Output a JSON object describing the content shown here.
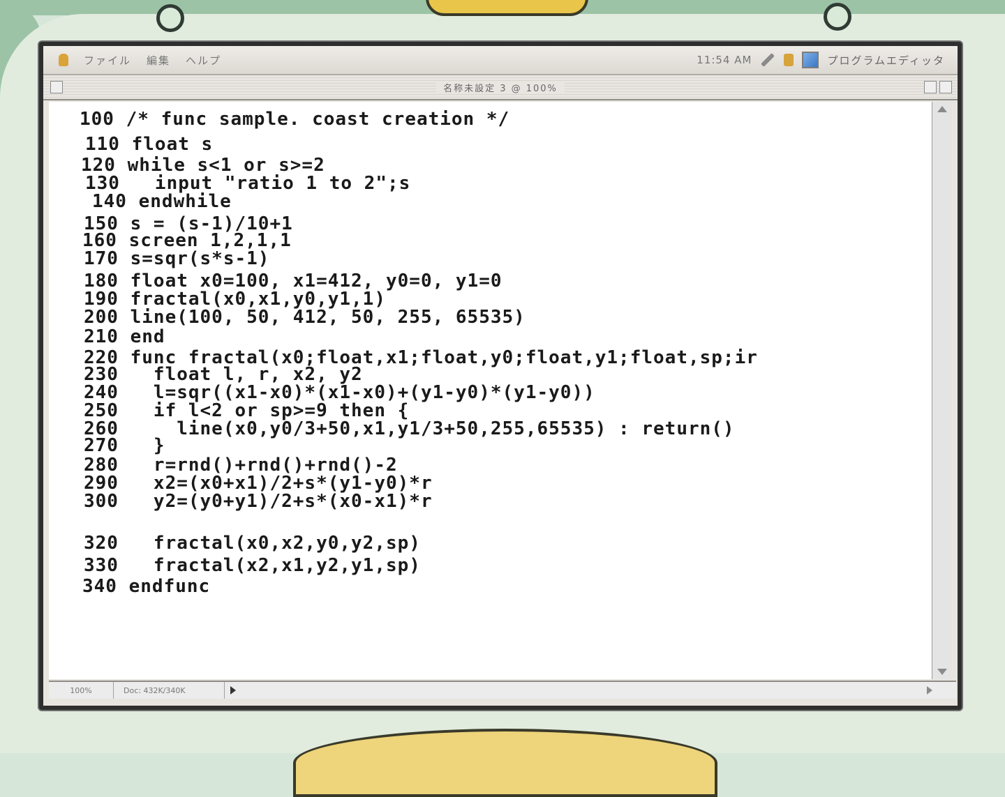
{
  "menubar": {
    "items": [
      "ファイル",
      "編集",
      "ヘルプ"
    ],
    "clock": "11:54 AM",
    "app_name": "プログラムエディッタ"
  },
  "window": {
    "title": "名称未設定 3 @ 100%"
  },
  "editor": {
    "lines": [
      "100 /* func sample. coast creation */",
      "110 float s",
      "120 while s<1 or s>=2",
      "130   input \"ratio 1 to 2\";s",
      "140 endwhile",
      "150 s = (s-1)/10+1",
      "160 screen 1,2,1,1",
      "170 s=sqr(s*s-1)",
      "180 float x0=100, x1=412, y0=0, y1=0",
      "190 fractal(x0,x1,y0,y1,1)",
      "200 line(100, 50, 412, 50, 255, 65535)",
      "210 end",
      "220 func fractal(x0;float,x1;float,y0;float,y1;float,sp;ir",
      "230   float l, r, x2, y2",
      "240   l=sqr((x1-x0)*(x1-x0)+(y1-y0)*(y1-y0))",
      "250   if l<2 or sp>=9 then {",
      "260     line(x0,y0/3+50,x1,y1/3+50,255,65535) : return()",
      "270   }",
      "280   r=rnd()+rnd()+rnd()-2",
      "290   x2=(x0+x1)/2+s*(y1-y0)*r",
      "300   y2=(y0+y1)/2+s*(x0-x1)*r",
      "320   fractal(x0,x2,y0,y2,sp)",
      "330   fractal(x2,x1,y2,y1,sp)",
      "340 endfunc"
    ]
  },
  "statusbar": {
    "zoom": "100%",
    "doc_info": "Doc: 432K/340K"
  },
  "colors": {
    "backdrop": "#d6e6d8",
    "accent_yellow": "#e9c54a",
    "editor_background": "#ffffff",
    "code_text": "#1a1a1a"
  }
}
